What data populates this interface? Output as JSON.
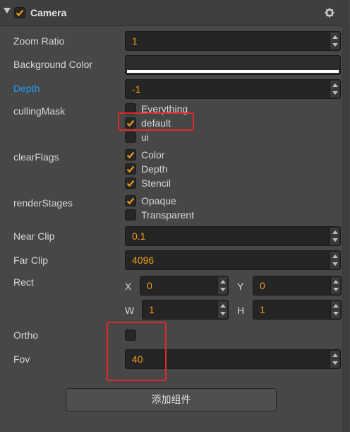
{
  "component": {
    "title": "Camera",
    "enabled": true
  },
  "fields": {
    "zoom_ratio": {
      "label": "Zoom Ratio",
      "value": "1"
    },
    "background_color": {
      "label": "Background Color",
      "color": "#ffffff"
    },
    "depth": {
      "label": "Depth",
      "value": "-1"
    },
    "culling_mask": {
      "label": "cullingMask",
      "options": [
        {
          "label": "Everything",
          "checked": false
        },
        {
          "label": "default",
          "checked": true
        },
        {
          "label": "ui",
          "checked": false
        }
      ]
    },
    "clear_flags": {
      "label": "clearFlags",
      "options": [
        {
          "label": "Color",
          "checked": true
        },
        {
          "label": "Depth",
          "checked": true
        },
        {
          "label": "Stencil",
          "checked": true
        }
      ]
    },
    "render_stages": {
      "label": "renderStages",
      "options": [
        {
          "label": "Opaque",
          "checked": true
        },
        {
          "label": "Transparent",
          "checked": false
        }
      ]
    },
    "near_clip": {
      "label": "Near Clip",
      "value": "0.1"
    },
    "far_clip": {
      "label": "Far Clip",
      "value": "4096"
    },
    "rect": {
      "label": "Rect",
      "x_label": "X",
      "x": "0",
      "y_label": "Y",
      "y": "0",
      "w_label": "W",
      "w": "1",
      "h_label": "H",
      "h": "1"
    },
    "ortho": {
      "label": "Ortho",
      "checked": false
    },
    "fov": {
      "label": "Fov",
      "value": "40"
    }
  },
  "add_component_button": "添加组件",
  "colors": {
    "accent": "#f39c12",
    "highlight": "#e02a2a",
    "label_active": "#1e9cf0"
  },
  "icons": {
    "collapse": "triangle-down-icon",
    "settings": "gear-icon",
    "check": "checkmark-icon"
  }
}
